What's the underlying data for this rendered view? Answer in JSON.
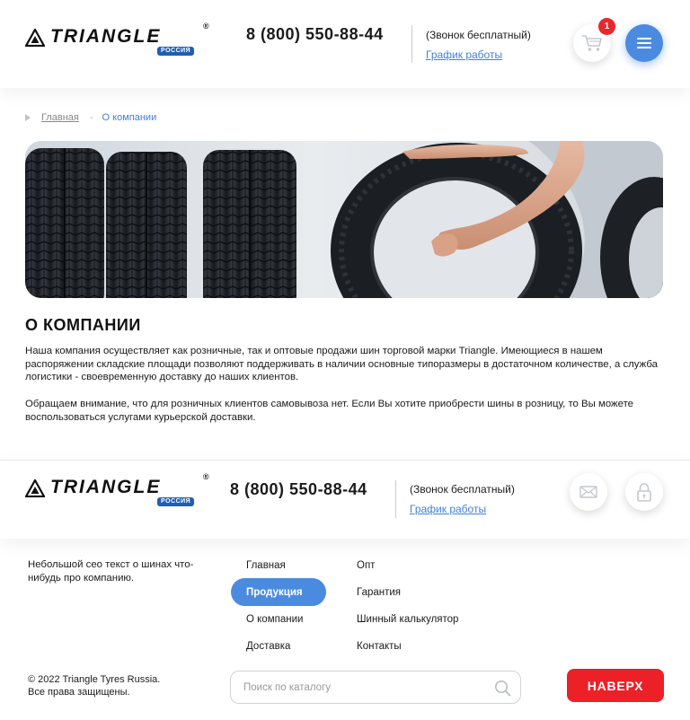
{
  "header": {
    "logo_text": "TRIANGLE",
    "logo_reg": "®",
    "logo_badge": "РОССИЯ",
    "phone": "8 (800) 550-88-44",
    "free_call": "(Звонок бесплатный)",
    "schedule_link": "График работы",
    "cart_count": "1",
    "cart_icon": "cart-icon",
    "menu_icon": "hamburger-icon"
  },
  "breadcrumb": {
    "home": "Главная",
    "separator": "-",
    "current": "О компании"
  },
  "main": {
    "title": "О КОМПАНИИ",
    "paragraph_1": "Наша компания осуществляет как розничные, так и оптовые продажи шин торговой марки Triangle. Имеющиеся в нашем распоряжении складские площади позволяют поддерживать в наличии основные типоразмеры в достаточном количестве, а служба логистики - своевременную доставку до наших клиентов.",
    "paragraph_2": "Обращаем внимание, что для розничных клиентов самовывоза нет. Если Вы хотите приобрести шины в розницу, то Вы можете воспользоваться услугами курьерской доставки."
  },
  "footer": {
    "logo_text": "TRIANGLE",
    "logo_reg": "®",
    "logo_badge": "РОССИЯ",
    "phone": "8 (800) 550-88-44",
    "free_call": "(Звонок бесплатный)",
    "schedule_link": "График работы",
    "mail_icon": "mail-icon",
    "lock_icon": "lock-icon",
    "seo_text": "Небольшой сео текст о шинах что-нибудь про компанию.",
    "nav_col1": [
      "Главная",
      "Продукция",
      "О компании",
      "Доставка"
    ],
    "nav_col2": [
      "Опт",
      "Гарантия",
      "Шинный калькулятор",
      "Контакты"
    ],
    "copyright_line1": "© 2022 Triangle Tyres Russia.",
    "copyright_line2": "Все права защищены.",
    "search_placeholder": "Поиск по каталогу",
    "to_top": "НАВЕРХ"
  },
  "colors": {
    "accent_blue": "#4a8be0",
    "link_blue": "#3f7fdc",
    "to_top_red": "#ec2027",
    "badge_blue": "#1f5fb4"
  }
}
